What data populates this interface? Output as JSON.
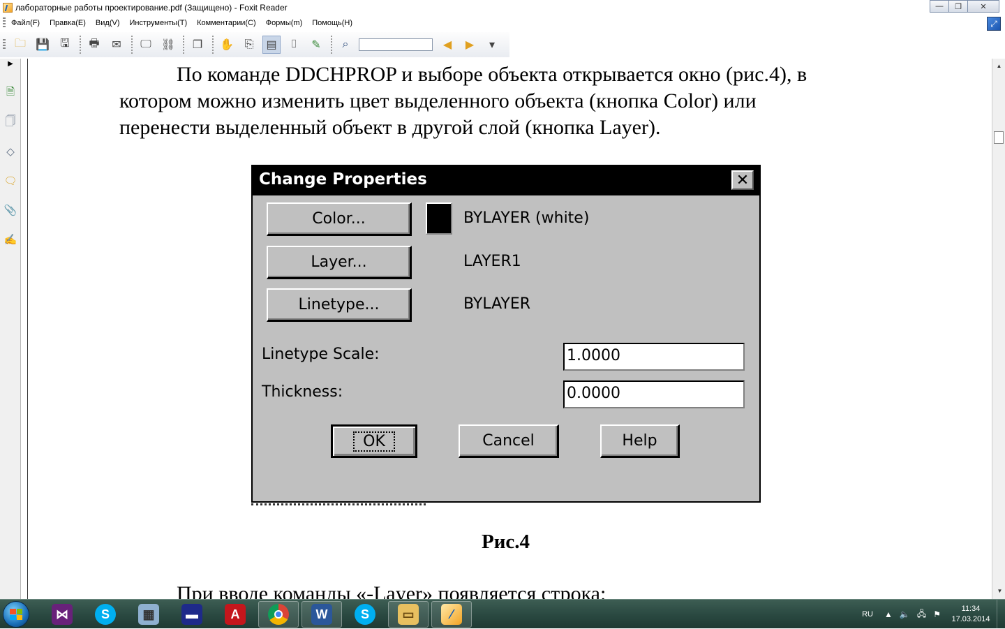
{
  "window": {
    "title": "лабораторные работы проектирование.pdf (Защищено) - Foxit Reader",
    "controls": {
      "minimize": "—",
      "restore": "❐",
      "close": "✕"
    }
  },
  "menu": {
    "items": [
      "Файл(F)",
      "Правка(E)",
      "Вид(V)",
      "Инструменты(T)",
      "Комментарии(C)",
      "Формы(m)",
      "Помощь(H)"
    ]
  },
  "toolbar": {
    "search_value": ""
  },
  "document": {
    "paragraph_line1": "По команде DDCHPROP и выборе объекта открывается окно (рис.4), в",
    "paragraph_line2": "котором можно изменить цвет выделенного объекта (кнопка Color) или",
    "paragraph_line3": "перенести выделенный объект в другой слой (кнопка Layer).",
    "figure_caption": "Рис.4",
    "next_line": "При  вводе команды «-Layer» появляется строка:"
  },
  "dialog": {
    "title": "Change Properties",
    "close_label": "✕",
    "color_button": "Color...",
    "color_value": "BYLAYER (white)",
    "swatch_color": "#000000",
    "layer_button": "Layer...",
    "layer_value": "LAYER1",
    "linetype_button": "Linetype...",
    "linetype_value": "BYLAYER",
    "linetype_scale_label": "Linetype Scale:",
    "linetype_scale_value": "1.0000",
    "thickness_label": "Thickness:",
    "thickness_value": "0.0000",
    "ok_button": "OK",
    "cancel_button": "Cancel",
    "help_button": "Help"
  },
  "taskbar": {
    "apps": [
      "visual-studio",
      "skype",
      "calculator",
      "save-disk",
      "autocad",
      "chrome",
      "word",
      "skype-2",
      "explorer",
      "foxit-reader"
    ],
    "language": "RU",
    "time": "11:34",
    "date": "17.03.2014"
  }
}
